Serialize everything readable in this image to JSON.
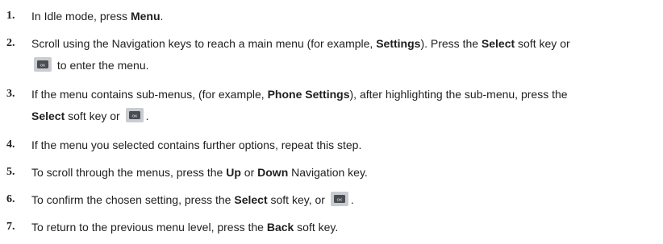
{
  "steps": [
    {
      "number": "1.",
      "parts": [
        "In Idle mode, press ",
        "Menu",
        "."
      ]
    },
    {
      "number": "2.",
      "parts": [
        "Scroll using the Navigation keys to reach a main menu (for example, ",
        "Settings",
        "). Press the ",
        "Select",
        " soft key or",
        "to enter the menu."
      ]
    },
    {
      "number": "3.",
      "parts": [
        "If the menu contains sub-menus, (for example, ",
        "Phone Settings",
        "), after highlighting the sub-menu, press the",
        "Select",
        " soft key or",
        "."
      ]
    },
    {
      "number": "4.",
      "parts": [
        "If the menu you selected contains further options, repeat this step."
      ]
    },
    {
      "number": "5.",
      "parts": [
        "To scroll through the menus, press the ",
        "Up",
        " or ",
        "Down",
        " Navigation key."
      ]
    },
    {
      "number": "6.",
      "parts": [
        "To confirm the chosen setting, press the ",
        "Select",
        " soft key, or",
        "."
      ]
    },
    {
      "number": "7.",
      "parts": [
        "To return to the previous menu level, press the ",
        "Back",
        " soft key."
      ]
    }
  ],
  "icons": {
    "ok_key": "ok-key-icon",
    "ok_key_label": "OK"
  },
  "colors": {
    "ok_key_outer": "#c9ccd0",
    "ok_key_inner": "#4a4d52",
    "text": "#1f1f1f"
  }
}
